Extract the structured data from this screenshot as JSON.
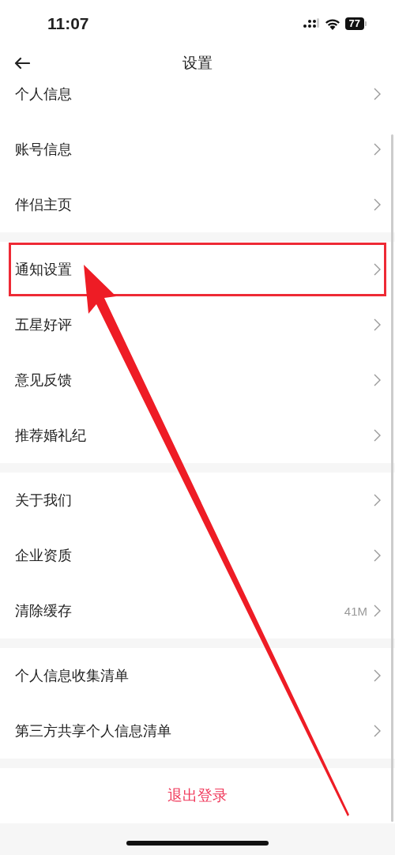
{
  "status_bar": {
    "time": "11:07",
    "battery": "77"
  },
  "nav": {
    "title": "设置"
  },
  "groups": [
    {
      "items": [
        {
          "label": "个人信息",
          "highlighted": false
        },
        {
          "label": "账号信息",
          "highlighted": false
        },
        {
          "label": "伴侣主页",
          "highlighted": false
        }
      ]
    },
    {
      "items": [
        {
          "label": "通知设置",
          "highlighted": true
        },
        {
          "label": "五星好评",
          "highlighted": false
        },
        {
          "label": "意见反馈",
          "highlighted": false
        },
        {
          "label": "推荐婚礼纪",
          "highlighted": false
        }
      ]
    },
    {
      "items": [
        {
          "label": "关于我们",
          "highlighted": false
        },
        {
          "label": "企业资质",
          "highlighted": false
        },
        {
          "label": "清除缓存",
          "value": "41M",
          "highlighted": false
        }
      ]
    },
    {
      "items": [
        {
          "label": "个人信息收集清单",
          "highlighted": false
        },
        {
          "label": "第三方共享个人信息清单",
          "highlighted": false
        }
      ]
    }
  ],
  "logout": {
    "label": "退出登录"
  }
}
